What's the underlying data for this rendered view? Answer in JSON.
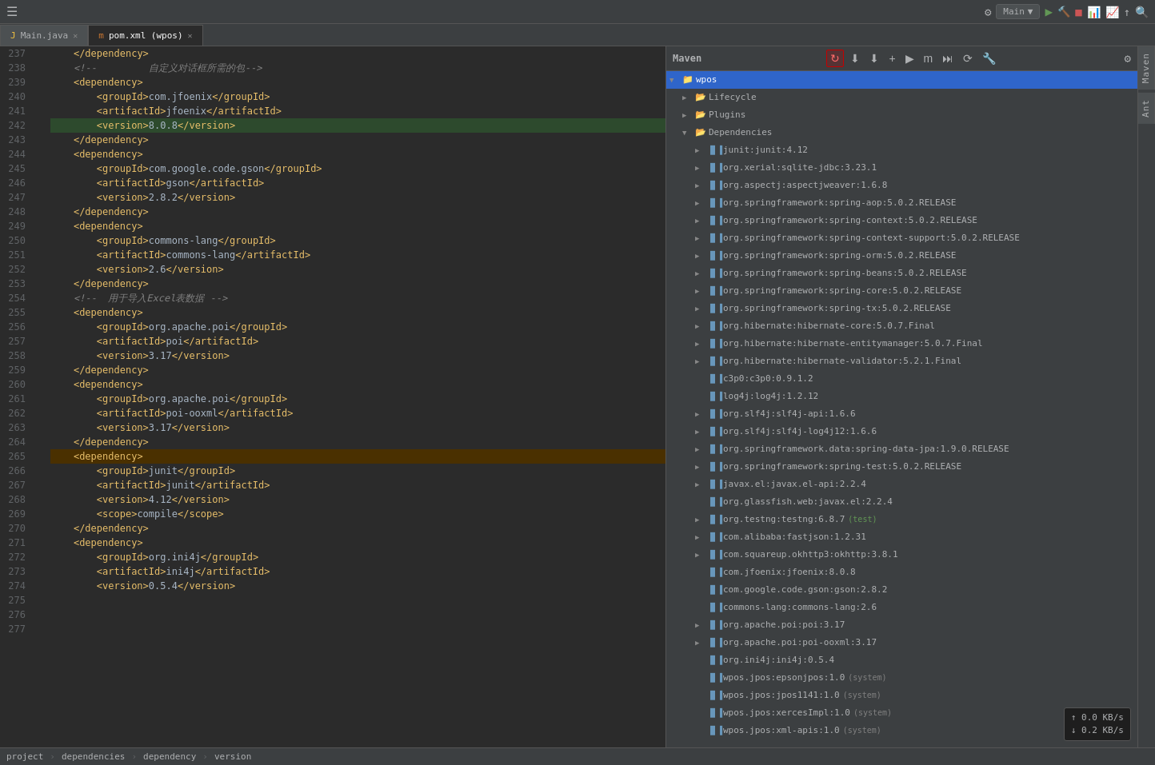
{
  "topbar": {
    "run_config_label": "Main",
    "run_icon": "▶",
    "build_icon": "🔨",
    "stop_icon": "■",
    "settings_icon": "⚙",
    "search_icon": "🔍"
  },
  "tabs": [
    {
      "id": "main-java",
      "label": "Main.java",
      "icon": "J",
      "active": false,
      "closable": true
    },
    {
      "id": "pom-xml",
      "label": "pom.xml (wpos)",
      "icon": "m",
      "active": true,
      "closable": true
    }
  ],
  "editor": {
    "lines": [
      {
        "num": 237,
        "indent": 2,
        "content": "    </dependency>",
        "type": "tag-close"
      },
      {
        "num": 238,
        "indent": 2,
        "content": "    <!--         自定义对话框所需的包-->",
        "type": "comment"
      },
      {
        "num": 239,
        "indent": 2,
        "content": "    <dependency>",
        "type": "tag-open"
      },
      {
        "num": 240,
        "indent": 3,
        "content": "        <groupId>com.jfoenix</groupId>",
        "type": "element"
      },
      {
        "num": 241,
        "indent": 3,
        "content": "        <artifactId>jfoenix</artifactId>",
        "type": "element"
      },
      {
        "num": 242,
        "indent": 3,
        "content": "        <version>8.0.8</version>",
        "type": "element",
        "highlight": true
      },
      {
        "num": 243,
        "indent": 2,
        "content": "    </dependency>",
        "type": "tag-close"
      },
      {
        "num": 244,
        "indent": 2,
        "content": "    <dependency>",
        "type": "tag-open"
      },
      {
        "num": 245,
        "indent": 3,
        "content": "        <groupId>com.google.code.gson</groupId>",
        "type": "element"
      },
      {
        "num": 246,
        "indent": 3,
        "content": "        <artifactId>gson</artifactId>",
        "type": "element"
      },
      {
        "num": 247,
        "indent": 3,
        "content": "        <version>2.8.2</version>",
        "type": "element"
      },
      {
        "num": 248,
        "indent": 2,
        "content": "    </dependency>",
        "type": "tag-close"
      },
      {
        "num": 249,
        "indent": 2,
        "content": "",
        "type": "blank"
      },
      {
        "num": 250,
        "indent": 2,
        "content": "    <dependency>",
        "type": "tag-open"
      },
      {
        "num": 251,
        "indent": 3,
        "content": "        <groupId>commons-lang</groupId>",
        "type": "element"
      },
      {
        "num": 252,
        "indent": 3,
        "content": "        <artifactId>commons-lang</artifactId>",
        "type": "element"
      },
      {
        "num": 253,
        "indent": 3,
        "content": "        <version>2.6</version>",
        "type": "element"
      },
      {
        "num": 254,
        "indent": 2,
        "content": "    </dependency>",
        "type": "tag-close"
      },
      {
        "num": 255,
        "indent": 2,
        "content": "",
        "type": "blank"
      },
      {
        "num": 256,
        "indent": 2,
        "content": "    <!--  用于导入Excel表数据 -->",
        "type": "comment"
      },
      {
        "num": 257,
        "indent": 2,
        "content": "    <dependency>",
        "type": "tag-open"
      },
      {
        "num": 258,
        "indent": 3,
        "content": "        <groupId>org.apache.poi</groupId>",
        "type": "element"
      },
      {
        "num": 259,
        "indent": 3,
        "content": "        <artifactId>poi</artifactId>",
        "type": "element"
      },
      {
        "num": 260,
        "indent": 3,
        "content": "        <version>3.17</version>",
        "type": "element"
      },
      {
        "num": 261,
        "indent": 2,
        "content": "    </dependency>",
        "type": "tag-close"
      },
      {
        "num": 262,
        "indent": 2,
        "content": "    <dependency>",
        "type": "tag-open"
      },
      {
        "num": 263,
        "indent": 3,
        "content": "        <groupId>org.apache.poi</groupId>",
        "type": "element"
      },
      {
        "num": 264,
        "indent": 3,
        "content": "        <artifactId>poi-ooxml</artifactId>",
        "type": "element"
      },
      {
        "num": 265,
        "indent": 3,
        "content": "        <version>3.17</version>",
        "type": "element"
      },
      {
        "num": 266,
        "indent": 2,
        "content": "    </dependency>",
        "type": "tag-close"
      },
      {
        "num": 267,
        "indent": 2,
        "content": "    <dependency>",
        "type": "tag-open",
        "highlighted_bg": true
      },
      {
        "num": 268,
        "indent": 3,
        "content": "        <groupId>junit</groupId>",
        "type": "element"
      },
      {
        "num": 269,
        "indent": 3,
        "content": "        <artifactId>junit</artifactId>",
        "type": "element"
      },
      {
        "num": 270,
        "indent": 3,
        "content": "        <version>4.12</version>",
        "type": "element"
      },
      {
        "num": 271,
        "indent": 3,
        "content": "        <scope>compile</scope>",
        "type": "element"
      },
      {
        "num": 272,
        "indent": 2,
        "content": "    </dependency>",
        "type": "tag-close"
      },
      {
        "num": 273,
        "indent": 2,
        "content": "",
        "type": "blank"
      },
      {
        "num": 274,
        "indent": 2,
        "content": "    <dependency>",
        "type": "tag-open"
      },
      {
        "num": 275,
        "indent": 3,
        "content": "        <groupId>org.ini4j</groupId>",
        "type": "element"
      },
      {
        "num": 276,
        "indent": 3,
        "content": "        <artifactId>ini4j</artifactId>",
        "type": "element"
      },
      {
        "num": 277,
        "indent": 3,
        "content": "        <version>0.5.4</version>",
        "type": "element"
      }
    ]
  },
  "maven": {
    "title": "Maven",
    "toolbar": {
      "refresh_label": "↻",
      "add_label": "+",
      "run_label": "▶",
      "skip_label": "m",
      "lifecycle_label": "⚡",
      "settings_label": "⚙",
      "refresh_highlighted": true
    },
    "tree": {
      "root": "wpos",
      "items": [
        {
          "id": "lifecycle",
          "label": "Lifecycle",
          "icon": "📋",
          "indent": 1,
          "expandable": true
        },
        {
          "id": "plugins",
          "label": "Plugins",
          "icon": "🔌",
          "indent": 1,
          "expandable": true
        },
        {
          "id": "dependencies",
          "label": "Dependencies",
          "icon": "📦",
          "indent": 1,
          "expandable": true,
          "expanded": true
        },
        {
          "id": "dep-junit",
          "label": "junit:junit:4.12",
          "indent": 2,
          "expandable": true
        },
        {
          "id": "dep-xerial",
          "label": "org.xerial:sqlite-jdbc:3.23.1",
          "indent": 2,
          "expandable": true
        },
        {
          "id": "dep-aspectj",
          "label": "org.aspectj:aspectjweaver:1.6.8",
          "indent": 2,
          "expandable": true
        },
        {
          "id": "dep-spring-aop",
          "label": "org.springframework:spring-aop:5.0.2.RELEASE",
          "indent": 2,
          "expandable": true
        },
        {
          "id": "dep-spring-context",
          "label": "org.springframework:spring-context:5.0.2.RELEASE",
          "indent": 2,
          "expandable": true
        },
        {
          "id": "dep-spring-context-support",
          "label": "org.springframework:spring-context-support:5.0.2.RELEASE",
          "indent": 2,
          "expandable": true
        },
        {
          "id": "dep-spring-orm",
          "label": "org.springframework:spring-orm:5.0.2.RELEASE",
          "indent": 2,
          "expandable": true
        },
        {
          "id": "dep-spring-beans",
          "label": "org.springframework:spring-beans:5.0.2.RELEASE",
          "indent": 2,
          "expandable": true
        },
        {
          "id": "dep-spring-core",
          "label": "org.springframework:spring-core:5.0.2.RELEASE",
          "indent": 2,
          "expandable": true
        },
        {
          "id": "dep-spring-tx",
          "label": "org.springframework:spring-tx:5.0.2.RELEASE",
          "indent": 2,
          "expandable": true
        },
        {
          "id": "dep-hibernate-core",
          "label": "org.hibernate:hibernate-core:5.0.7.Final",
          "indent": 2,
          "expandable": true
        },
        {
          "id": "dep-hibernate-entitymanager",
          "label": "org.hibernate:hibernate-entitymanager:5.0.7.Final",
          "indent": 2,
          "expandable": true
        },
        {
          "id": "dep-hibernate-validator",
          "label": "org.hibernate:hibernate-validator:5.2.1.Final",
          "indent": 2,
          "expandable": true
        },
        {
          "id": "dep-c3p0",
          "label": "c3p0:c3p0:0.9.1.2",
          "indent": 2,
          "expandable": false
        },
        {
          "id": "dep-log4j",
          "label": "log4j:log4j:1.2.12",
          "indent": 2,
          "expandable": false
        },
        {
          "id": "dep-slf4j-api",
          "label": "org.slf4j:slf4j-api:1.6.6",
          "indent": 2,
          "expandable": true
        },
        {
          "id": "dep-slf4j-log4j",
          "label": "org.slf4j:slf4j-log4j12:1.6.6",
          "indent": 2,
          "expandable": true
        },
        {
          "id": "dep-spring-data-jpa",
          "label": "org.springframework.data:spring-data-jpa:1.9.0.RELEASE",
          "indent": 2,
          "expandable": true
        },
        {
          "id": "dep-spring-test",
          "label": "org.springframework:spring-test:5.0.2.RELEASE",
          "indent": 2,
          "expandable": true
        },
        {
          "id": "dep-javax-el",
          "label": "javax.el:javax.el-api:2.2.4",
          "indent": 2,
          "expandable": true
        },
        {
          "id": "dep-glassfish",
          "label": "org.glassfish.web:javax.el:2.2.4",
          "indent": 2,
          "expandable": false
        },
        {
          "id": "dep-testng",
          "label": "org.testng:testng:6.8.7",
          "indent": 2,
          "expandable": true,
          "badge": "test"
        },
        {
          "id": "dep-fastjson",
          "label": "com.alibaba:fastjson:1.2.31",
          "indent": 2,
          "expandable": true
        },
        {
          "id": "dep-okhttp",
          "label": "com.squareup.okhttp3:okhttp:3.8.1",
          "indent": 2,
          "expandable": true
        },
        {
          "id": "dep-jfoenix",
          "label": "com.jfoenix:jfoenix:8.0.8",
          "indent": 2,
          "expandable": false
        },
        {
          "id": "dep-gson",
          "label": "com.google.code.gson:gson:2.8.2",
          "indent": 2,
          "expandable": false
        },
        {
          "id": "dep-commons-lang",
          "label": "commons-lang:commons-lang:2.6",
          "indent": 2,
          "expandable": false
        },
        {
          "id": "dep-poi",
          "label": "org.apache.poi:poi:3.17",
          "indent": 2,
          "expandable": true
        },
        {
          "id": "dep-poi-ooxml",
          "label": "org.apache.poi:poi-ooxml:3.17",
          "indent": 2,
          "expandable": true
        },
        {
          "id": "dep-ini4j",
          "label": "org.ini4j:ini4j:0.5.4",
          "indent": 2,
          "expandable": false
        },
        {
          "id": "dep-epsonj",
          "label": "wpos.jpos:epsonjpos:1.0",
          "indent": 2,
          "expandable": false,
          "badge": "system"
        },
        {
          "id": "dep-jpos1141",
          "label": "wpos.jpos:jpos1141:1.0",
          "indent": 2,
          "expandable": false,
          "badge": "system"
        },
        {
          "id": "dep-xercesimpl",
          "label": "wpos.jpos:xercesImpl:1.0",
          "indent": 2,
          "expandable": false,
          "badge": "system"
        },
        {
          "id": "dep-xml-apis",
          "label": "wpos.jpos:xml-apis:1.0",
          "indent": 2,
          "expandable": false,
          "badge": "system"
        }
      ]
    },
    "speed": {
      "upload": "↑ 0.0 KB/s",
      "download": "↓ 0.2 KB/s"
    }
  },
  "breadcrumb": {
    "items": [
      "project",
      "dependencies",
      "dependency",
      "version"
    ]
  },
  "sidebar_labels": [
    "Maven",
    "Ant"
  ]
}
